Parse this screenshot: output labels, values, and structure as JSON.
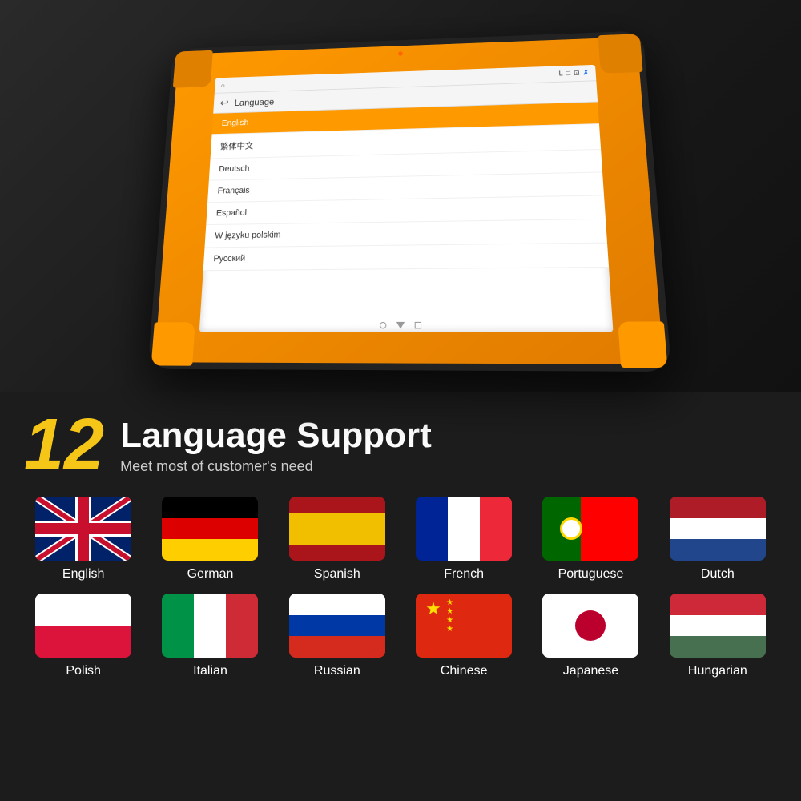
{
  "tablet": {
    "status_icons": "○ L □ ⊡ ✗",
    "camera_dot": true,
    "app_bar_title": "Language",
    "languages_list": [
      {
        "label": "English",
        "selected": true
      },
      {
        "label": "繁体中文",
        "selected": false
      },
      {
        "label": "Deutsch",
        "selected": false
      },
      {
        "label": "Français",
        "selected": false
      },
      {
        "label": "Español",
        "selected": false
      },
      {
        "label": "W języku polskim",
        "selected": false
      },
      {
        "label": "Русский",
        "selected": false
      }
    ]
  },
  "bottom": {
    "number": "12",
    "title": "Language Support",
    "subtitle": "Meet most of customer's need",
    "languages": [
      {
        "name": "English",
        "flag": "uk"
      },
      {
        "name": "German",
        "flag": "german"
      },
      {
        "name": "Spanish",
        "flag": "spanish"
      },
      {
        "name": "French",
        "flag": "french"
      },
      {
        "name": "Portuguese",
        "flag": "portuguese"
      },
      {
        "name": "Dutch",
        "flag": "dutch"
      },
      {
        "name": "Polish",
        "flag": "polish"
      },
      {
        "name": "Italian",
        "flag": "italian"
      },
      {
        "name": "Russian",
        "flag": "russian"
      },
      {
        "name": "Chinese",
        "flag": "chinese"
      },
      {
        "name": "Japanese",
        "flag": "japanese"
      },
      {
        "name": "Hungarian",
        "flag": "hungarian"
      }
    ]
  }
}
